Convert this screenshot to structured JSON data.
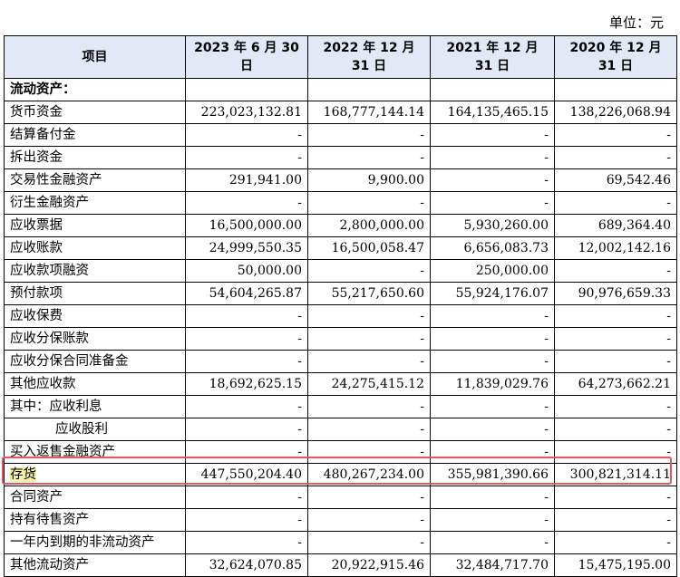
{
  "unit_label": "单位：元",
  "headers": [
    "项目",
    "2023 年 6 月 30 日",
    "2022 年 12 月 31 日",
    "2021 年 12 月 31 日",
    "2020 年 12 月 31 日"
  ],
  "rows": [
    {
      "label": "流动资产：",
      "v": [
        "",
        "",
        "",
        ""
      ]
    },
    {
      "label": "货币资金",
      "v": [
        "223,023,132.81",
        "168,777,144.14",
        "164,135,465.15",
        "138,226,068.94"
      ]
    },
    {
      "label": "结算备付金",
      "v": [
        "-",
        "-",
        "-",
        "-"
      ]
    },
    {
      "label": "拆出资金",
      "v": [
        "-",
        "-",
        "-",
        "-"
      ]
    },
    {
      "label": "交易性金融资产",
      "v": [
        "291,941.00",
        "9,900.00",
        "-",
        "69,542.46"
      ]
    },
    {
      "label": "衍生金融资产",
      "v": [
        "-",
        "-",
        "-",
        "-"
      ]
    },
    {
      "label": "应收票据",
      "v": [
        "16,500,000.00",
        "2,800,000.00",
        "5,930,260.00",
        "689,364.40"
      ]
    },
    {
      "label": "应收账款",
      "v": [
        "24,999,550.35",
        "16,500,058.47",
        "6,656,083.73",
        "12,002,142.16"
      ]
    },
    {
      "label": "应收款项融资",
      "v": [
        "50,000.00",
        "-",
        "250,000.00",
        "-"
      ]
    },
    {
      "label": "预付款项",
      "v": [
        "54,604,265.87",
        "55,217,650.60",
        "55,924,176.07",
        "90,976,659.33"
      ]
    },
    {
      "label": "应收保费",
      "v": [
        "-",
        "-",
        "-",
        "-"
      ]
    },
    {
      "label": "应收分保账款",
      "v": [
        "-",
        "-",
        "-",
        "-"
      ]
    },
    {
      "label": "应收分保合同准备金",
      "v": [
        "-",
        "-",
        "-",
        "-"
      ]
    },
    {
      "label": "其他应收款",
      "v": [
        "18,692,625.15",
        "24,275,415.12",
        "11,839,029.76",
        "64,273,662.21"
      ]
    },
    {
      "label": "其中：应收利息",
      "v": [
        "-",
        "-",
        "-",
        "-"
      ]
    },
    {
      "label": "应收股利",
      "v": [
        "-",
        "-",
        "-",
        "-"
      ]
    },
    {
      "label": "买入返售金融资产",
      "v": [
        "-",
        "-",
        "-",
        "-"
      ]
    },
    {
      "label": "存货",
      "v": [
        "447,550,204.40",
        "480,267,234.00",
        "355,981,390.66",
        "300,821,314.11"
      ]
    },
    {
      "label": "合同资产",
      "v": [
        "-",
        "-",
        "-",
        "-"
      ]
    },
    {
      "label": "持有待售资产",
      "v": [
        "-",
        "-",
        "-",
        "-"
      ]
    },
    {
      "label": "一年内到期的非流动资产",
      "v": [
        "-",
        "-",
        "-",
        "-"
      ]
    },
    {
      "label": "其他流动资产",
      "v": [
        "32,624,070.85",
        "20,922,915.46",
        "32,484,717.70",
        "15,475,195.00"
      ]
    }
  ],
  "highlight_color": "#e8555f",
  "header_bg": "#e0e9f5"
}
